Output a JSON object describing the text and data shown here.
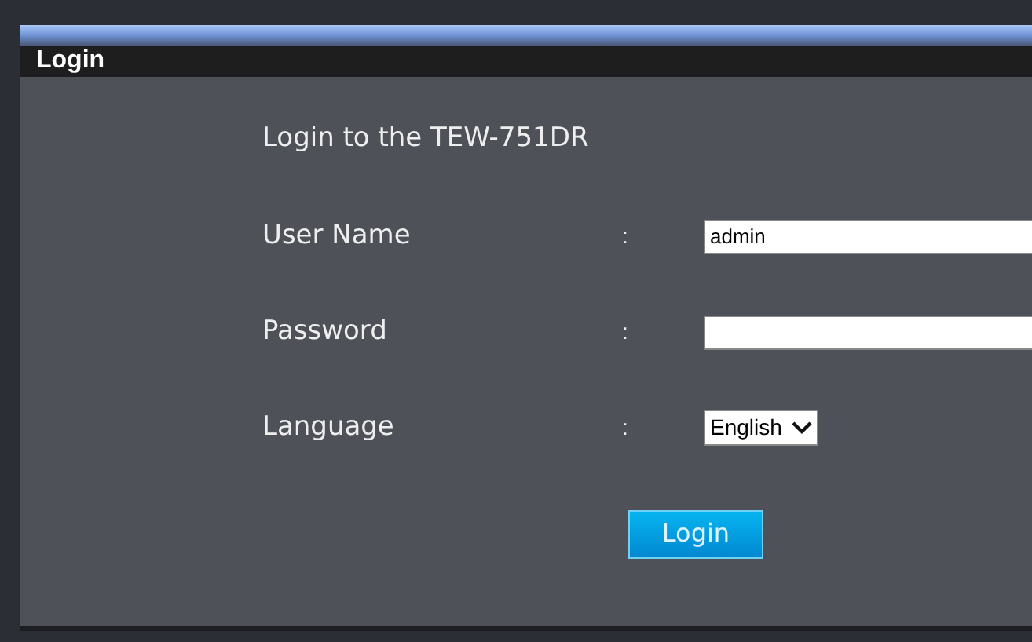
{
  "panel": {
    "title": "Login"
  },
  "heading": "Login to the TEW-751DR",
  "fields": [
    {
      "kind": "text",
      "label": "User Name",
      "separator": ":",
      "value": "admin"
    },
    {
      "kind": "password",
      "label": "Password",
      "separator": ":"
    },
    {
      "kind": "select",
      "label": "Language",
      "separator": ":",
      "value": "English"
    }
  ],
  "button": "Login"
}
